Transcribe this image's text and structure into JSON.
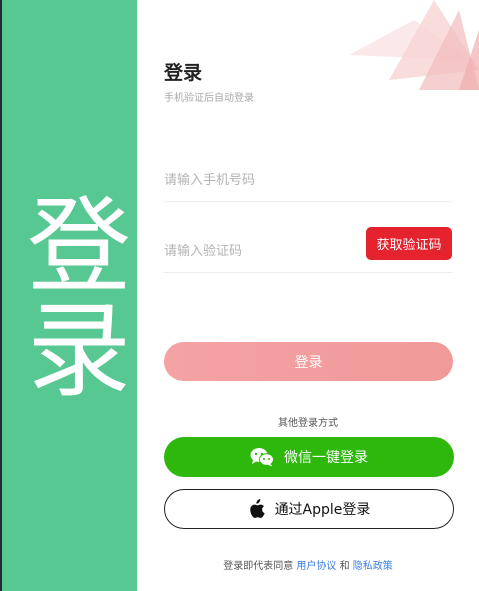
{
  "side_panel": {
    "label": "登录"
  },
  "header": {
    "title": "登录",
    "subtitle": "手机验证后自动登录"
  },
  "phone_field": {
    "placeholder": "请输入手机号码"
  },
  "code_field": {
    "placeholder": "请输入验证码",
    "get_code_label": "获取验证码"
  },
  "login_button": {
    "label": "登录"
  },
  "other_methods": {
    "label": "其他登录方式",
    "wechat_label": "微信一键登录",
    "apple_label": "通过Apple登录"
  },
  "agreement": {
    "prefix": "登录即代表同意",
    "user_agreement": "用户协议",
    "and": "和",
    "privacy_policy": "隐私政策"
  },
  "colors": {
    "side_panel": "#58c892",
    "get_code": "#e5232f",
    "login_button": "#f4a2a2",
    "wechat": "#2db80b",
    "link": "#3a7fe0"
  },
  "icons": {
    "wechat": "wechat-icon",
    "apple": "apple-icon"
  }
}
